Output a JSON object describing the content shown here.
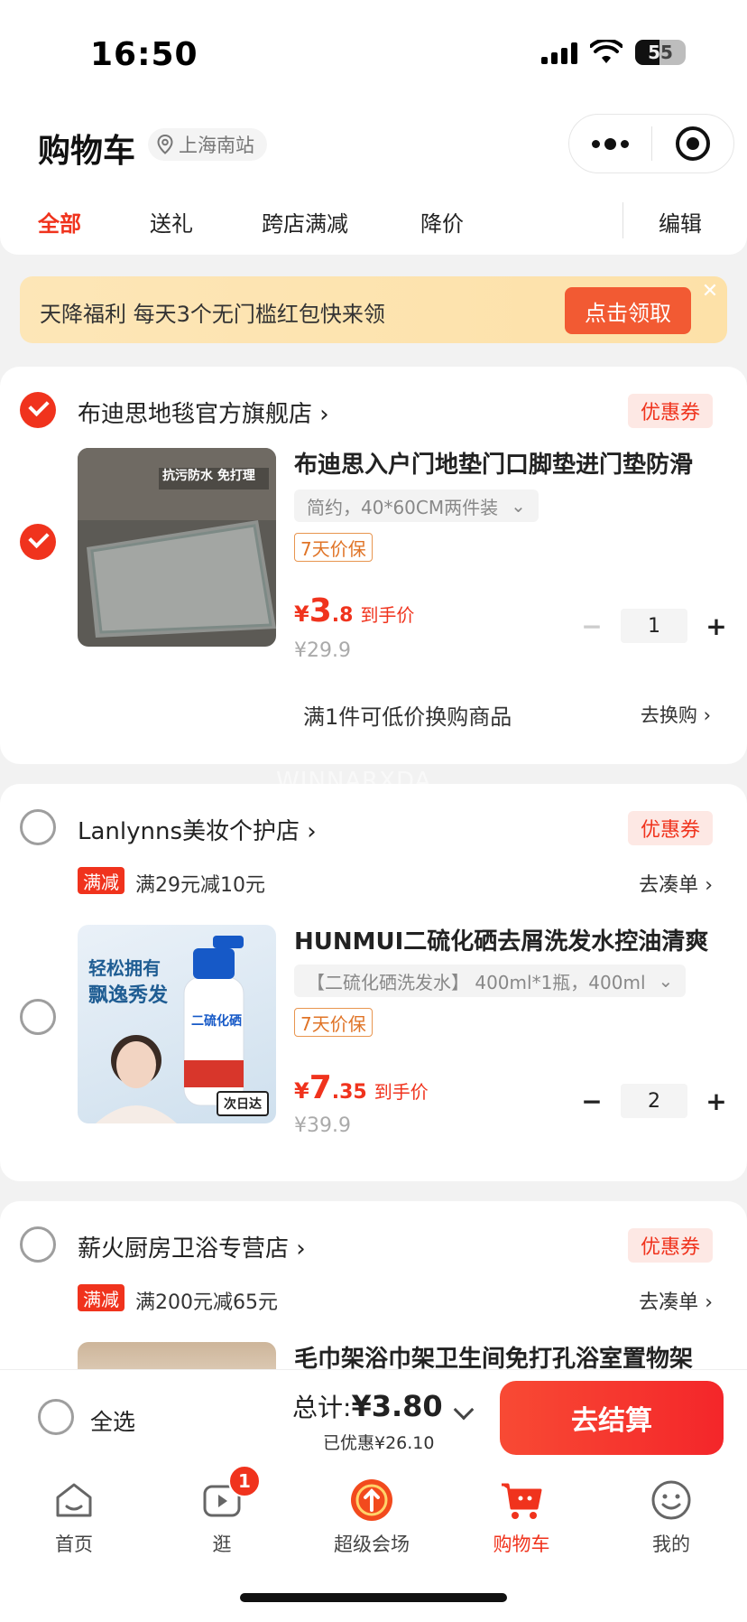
{
  "status_bar": {
    "time": "16:50",
    "battery": "55"
  },
  "header": {
    "title": "购物车",
    "location": "上海南站"
  },
  "tabs": [
    {
      "label": "全部",
      "active": true
    },
    {
      "label": "送礼",
      "active": false
    },
    {
      "label": "跨店满减",
      "active": false
    },
    {
      "label": "降价",
      "active": false
    }
  ],
  "edit_label": "编辑",
  "banner": {
    "text": "天降福利 每天3个无门槛红包快来领",
    "button": "点击领取",
    "close": "✕"
  },
  "stores": [
    {
      "name": "布迪思地毯官方旗舰店",
      "checked": true,
      "coupon": "优惠券",
      "product": {
        "title": "布迪思入户门地垫门口脚垫进门垫防滑",
        "sku": "简约，40*60CM两件装",
        "badge": "7天价保",
        "price_currency": "¥",
        "price_int": "3",
        "price_dec": ".8",
        "price_label": "到手价",
        "original": "¥29.9",
        "quantity": "1",
        "thumb_text": "抗污防水 免打理",
        "checked": true
      },
      "exchange": {
        "text": "满1件可低价换购商品",
        "link": "去换购"
      }
    },
    {
      "name": "Lanlynns美妆个护店",
      "checked": false,
      "coupon": "优惠券",
      "promo": {
        "tag": "满减",
        "text": "满29元减10元",
        "link": "去凑单"
      },
      "product": {
        "title": "HUNMUI二硫化硒去屑洗发水控油清爽",
        "sku": "【二硫化硒洗发水】 400ml*1瓶，400ml",
        "badge": "7天价保",
        "price_currency": "¥",
        "price_int": "7",
        "price_dec": ".35",
        "price_label": "到手价",
        "original": "¥39.9",
        "quantity": "2",
        "thumb_line1": "轻松拥有",
        "thumb_line2": "飘逸秀发",
        "thumb_tag": "次日达",
        "bottle_label": "二硫化硒",
        "checked": false
      }
    },
    {
      "name": "薪火厨房卫浴专营店",
      "checked": false,
      "coupon": "优惠券",
      "promo": {
        "tag": "满减",
        "text": "满200元减65元",
        "link": "去凑单"
      },
      "product": {
        "title": "毛巾架浴巾架卫生间免打孔浴室置物架"
      }
    }
  ],
  "watermark": "WINNARXDA",
  "checkout": {
    "select_all": "全选",
    "total_label": "总计:",
    "total_amount": "¥3.80",
    "saved": "已优惠¥26.10",
    "pay_button": "去结算"
  },
  "tabbar": [
    {
      "label": "首页",
      "icon": "home-icon"
    },
    {
      "label": "逛",
      "icon": "video-icon",
      "badge": "1"
    },
    {
      "label": "超级会场",
      "icon": "super-venue-icon"
    },
    {
      "label": "购物车",
      "icon": "cart-icon",
      "active": true
    },
    {
      "label": "我的",
      "icon": "profile-icon"
    }
  ],
  "colors": {
    "accent": "#f0331d",
    "banner_bg": "#fde6b7",
    "coupon_bg": "#fde8e4"
  }
}
